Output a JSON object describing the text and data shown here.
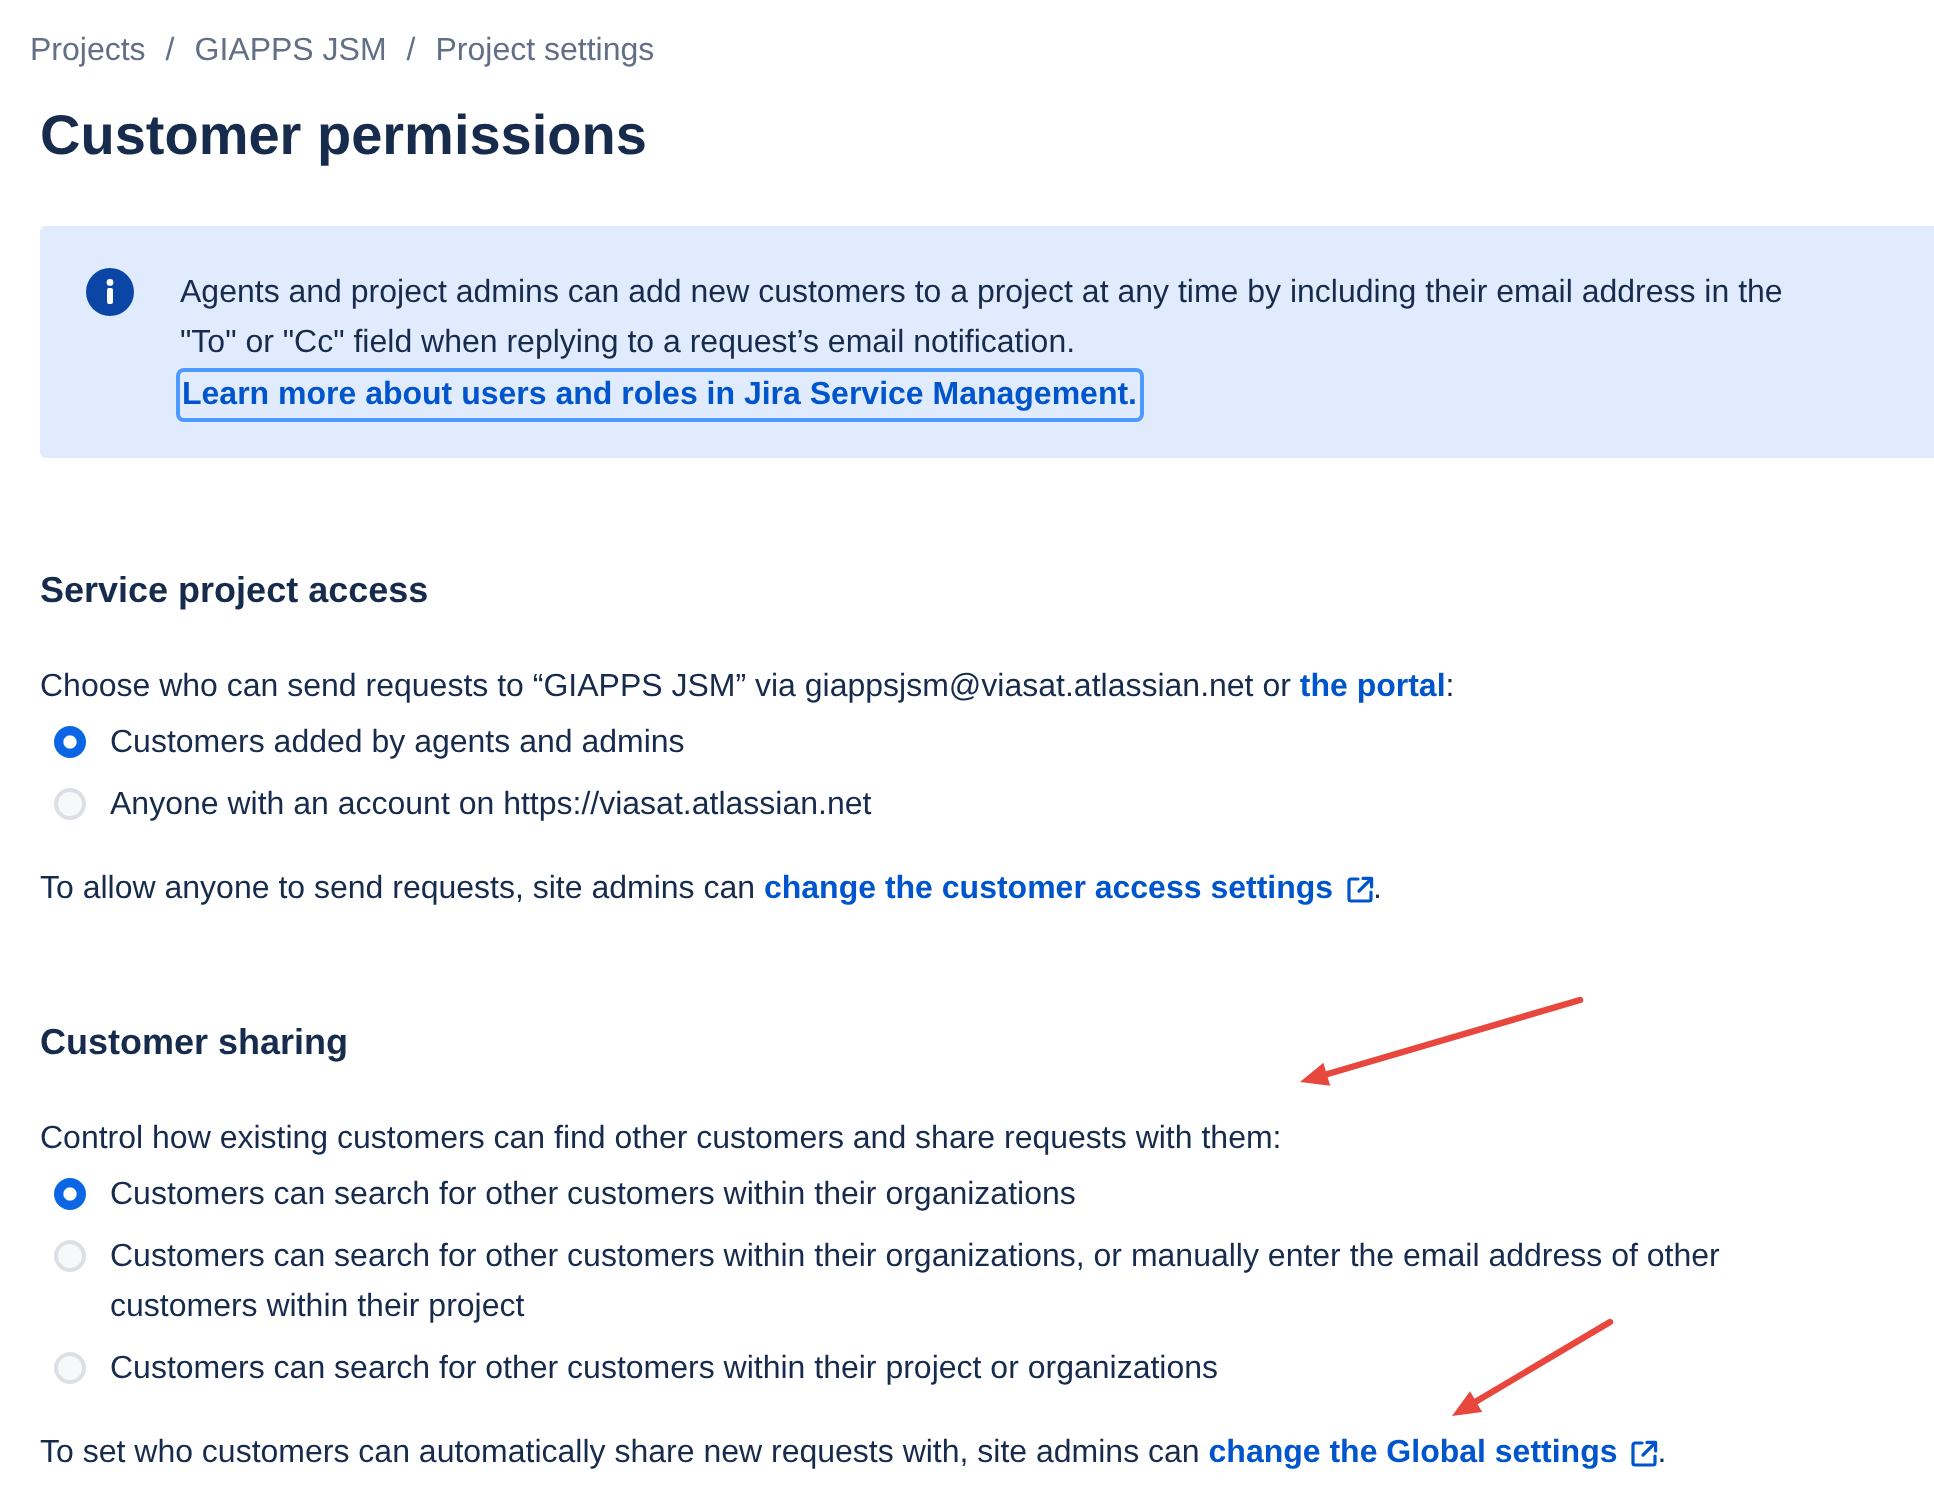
{
  "breadcrumbs": [
    {
      "kind": "crumb",
      "text": "Projects"
    },
    {
      "kind": "separator",
      "text": "/"
    },
    {
      "kind": "crumb",
      "text": "GIAPPS JSM"
    },
    {
      "kind": "separator",
      "text": "/"
    },
    {
      "kind": "crumb",
      "text": "Project settings"
    }
  ],
  "title": "Customer permissions",
  "info_panel": {
    "lines": [
      "Agents and project admins can add new customers to a project at any time by including their email address in the",
      "\"To\" or \"Cc\" field when replying to a request’s email notification."
    ],
    "link": {
      "text": "Learn more about users and roles in Jira Service Management.",
      "focused": true
    }
  },
  "sections": [
    {
      "heading": "Service project access",
      "prompt": [
        {
          "kind": "text",
          "text": "Choose who can send requests to “GIAPPS JSM” via giappsjsm@viasat.atlassian.net or "
        },
        {
          "kind": "link",
          "text": "the portal"
        },
        {
          "kind": "text",
          "text": ":"
        }
      ],
      "options": [
        {
          "label": "Customers added by agents and admins",
          "selected": true
        },
        {
          "label": "Anyone with an account on https://viasat.atlassian.net",
          "selected": false
        }
      ],
      "note": [
        {
          "kind": "text",
          "text": "To allow anyone to send requests, site admins can "
        },
        {
          "kind": "external_link",
          "text": "change the customer access settings"
        },
        {
          "kind": "text",
          "text": "."
        }
      ]
    },
    {
      "heading": "Customer sharing",
      "prompt": [
        {
          "kind": "text",
          "text": "Control how existing customers can find other customers and share requests with them:"
        }
      ],
      "options": [
        {
          "label": "Customers can search for other customers within their organizations",
          "selected": true
        },
        {
          "label": "Customers can search for other customers within their organizations, or manually enter the email address of other customers within their project",
          "selected": false
        },
        {
          "label": "Customers can search for other customers within their project or organizations",
          "selected": false
        }
      ],
      "note": [
        {
          "kind": "text",
          "text": "To set who customers can automatically share new requests with, site admins can "
        },
        {
          "kind": "external_link",
          "text": "change the Global settings"
        },
        {
          "kind": "text",
          "text": "."
        }
      ]
    }
  ],
  "annotations": [
    {
      "kind": "arrow"
    },
    {
      "kind": "arrow"
    }
  ]
}
